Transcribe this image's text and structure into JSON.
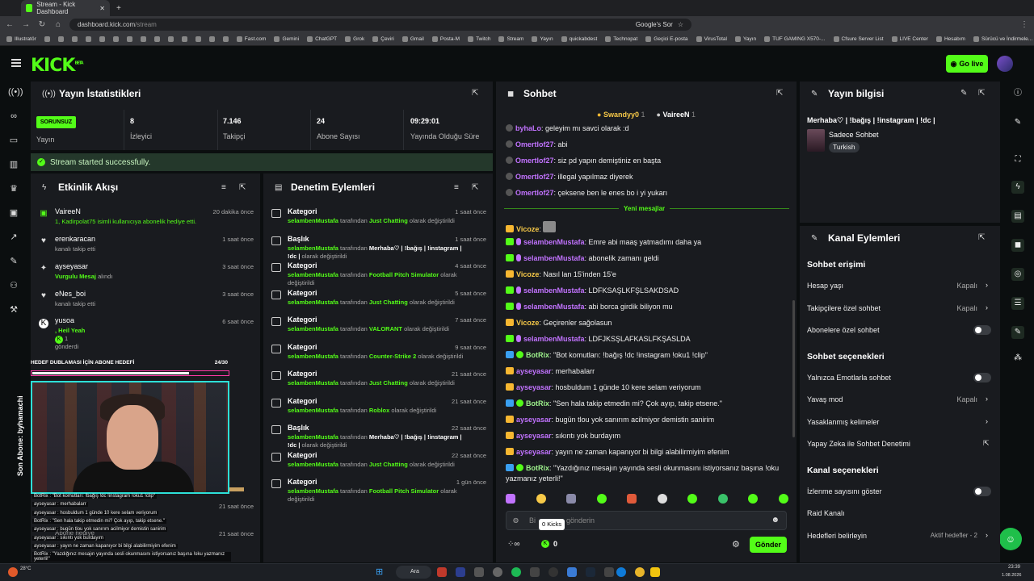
{
  "browser": {
    "tab_title": "Stream - Kick Dashboard",
    "url_host": "dashboard.kick.com",
    "url_path": "/stream",
    "search_chip": "Google's Sor",
    "bookmarks": [
      "Illustratör",
      "",
      "",
      "",
      "",
      "",
      "",
      "",
      "",
      "",
      "",
      "",
      "",
      "",
      "",
      "Fast.com",
      "Gemini",
      "ChatGPT",
      "Grok",
      "Çeviri",
      "Gmail",
      "Posta-M",
      "Twitch",
      "Stream",
      "Yayın",
      "quickabdest",
      "Technopat",
      "Geçici E-posta",
      "VirusTotal",
      "Yayın",
      "TUF GAMING X570-...",
      "Cfsure Server List",
      "LIVE Center",
      "Hesabım",
      "Sürücü ve İndirmele..."
    ]
  },
  "header": {
    "logo": "KICK",
    "logo_sup": "BETA",
    "golive_label": "Go live"
  },
  "stats": {
    "title": "Yayın İstatistikleri",
    "status_badge": "SORUNSUZ",
    "status_label": "Yayın",
    "items": [
      {
        "value": "8",
        "label": "İzleyici"
      },
      {
        "value": "7.146",
        "label": "Takipçi"
      },
      {
        "value": "24",
        "label": "Abone Sayısı"
      },
      {
        "value": "09:29:01",
        "label": "Yayında Olduğu Süre"
      }
    ],
    "started_msg": "Stream started successfully."
  },
  "activity": {
    "title": "Etkinlik Akışı",
    "items": [
      {
        "name": "VaireeN",
        "sub": "1, Kadirpolat75 isimli kullanıcıya abonelik hediye etti.",
        "time": "20 dakika önce"
      },
      {
        "name": "erenkaracan",
        "sub": "kanalı takip etti",
        "time": "1 saat önce"
      },
      {
        "name": "ayseyasar",
        "sub_green": "Vurgulu Mesaj",
        "sub": " alındı",
        "time": "3 saat önce"
      },
      {
        "name": "eNes_boi",
        "sub": "kanalı takip etti",
        "time": "3 saat önce"
      },
      {
        "name": "yusoa",
        "sub_green": ", Heil Yeah",
        "sub2": "1",
        "sub3": "gönderdi",
        "time": "6 saat önce"
      }
    ],
    "hidden_times": [
      "21 saat önce",
      "21 saat önce"
    ]
  },
  "moderation": {
    "title": "Denetim Eylemleri",
    "items": [
      {
        "type": "Kategori",
        "user": "selambenMustafa",
        "mid": " tarafından ",
        "target": "Just Chatting",
        "end": " olarak değiştirildi",
        "time": "1 saat önce"
      },
      {
        "type": "Başlık",
        "user": "selambenMustafa",
        "mid": " tarafından ",
        "target": "Merhaba♡ | !bağış | !instagram | !dc |",
        "end": " olarak değiştirildi",
        "time": "1 saat önce"
      },
      {
        "type": "Kategori",
        "user": "selambenMustafa",
        "mid": " tarafından ",
        "target": "Football Pitch Simulator",
        "end": " olarak değiştirildi",
        "time": "4 saat önce"
      },
      {
        "type": "Kategori",
        "user": "selambenMustafa",
        "mid": " tarafından ",
        "target": "Just Chatting",
        "end": " olarak değiştirildi",
        "time": "5 saat önce"
      },
      {
        "type": "Kategori",
        "user": "selambenMustafa",
        "mid": " tarafından ",
        "target": "VALORANT",
        "end": " olarak değiştirildi",
        "time": "7 saat önce"
      },
      {
        "type": "Kategori",
        "user": "selambenMustafa",
        "mid": " tarafından ",
        "target": "Counter-Strike 2",
        "end": " olarak değiştirildi",
        "time": "9 saat önce"
      },
      {
        "type": "Kategori",
        "user": "selambenMustafa",
        "mid": " tarafından ",
        "target": "Just Chatting",
        "end": " olarak değiştirildi",
        "time": "21 saat önce"
      },
      {
        "type": "Kategori",
        "user": "selambenMustafa",
        "mid": " tarafından ",
        "target": "Roblox",
        "end": " olarak değiştirildi",
        "time": "21 saat önce"
      },
      {
        "type": "Başlık",
        "user": "selambenMustafa",
        "mid": " tarafından ",
        "target": "Merhaba♡ | !bağış | !instagram | !dc |",
        "end": " olarak değiştirildi",
        "time": "22 saat önce"
      },
      {
        "type": "Kategori",
        "user": "selambenMustafa",
        "mid": " tarafından ",
        "target": "Just Chatting",
        "end": " olarak değiştirildi",
        "time": "22 saat önce"
      },
      {
        "type": "Kategori",
        "user": "selambenMustafa",
        "mid": " tarafından ",
        "target": "Football Pitch Simulator",
        "end": " olarak değiştirildi",
        "time": "1 gün önce"
      }
    ]
  },
  "chat": {
    "title": "Sohbet",
    "top_gifters": [
      {
        "name": "Swandyy0",
        "count": "1"
      },
      {
        "name": "VaireeN",
        "count": "1"
      }
    ],
    "old_messages": [
      {
        "user": "byhaLo",
        "text": ": geleyim mı savci olarak :d"
      },
      {
        "user": "Omertlof27",
        "text": ": abi"
      },
      {
        "user": "Omertlof27",
        "text": ": siz pd yapın demiştiniz en başta"
      },
      {
        "user": "Omertlof27",
        "text": ": illegal yapılmaz diyerek"
      },
      {
        "user": "Omertlof27",
        "text": ": çeksene ben le enes bo i yi yukarı"
      }
    ],
    "new_divider": "Yeni mesajlar",
    "new_messages": [
      {
        "user": "Vicoze",
        "text": ": ",
        "kind": "crown",
        "color": "yellow"
      },
      {
        "user": "selambenMustafa",
        "text": ": Emre abi maaş yatmadımı daha ya",
        "kind": "mod",
        "color": "purple"
      },
      {
        "user": "selambenMustafa",
        "text": ": abonelik zamanı geldi",
        "kind": "mod",
        "color": "purple"
      },
      {
        "user": "Vicoze",
        "text": ": Nasıl lan 15'inden 15'e",
        "kind": "crown",
        "color": "yellow"
      },
      {
        "user": "selambenMustafa",
        "text": ": LDFKSAŞLKFŞLSAKDSAD",
        "kind": "mod",
        "color": "purple"
      },
      {
        "user": "selambenMustafa",
        "text": ": abi borca girdik biliyon mu",
        "kind": "mod",
        "color": "purple"
      },
      {
        "user": "Vicoze",
        "text": ": Geçirenler sağolasun",
        "kind": "crown",
        "color": "yellow"
      },
      {
        "user": "selambenMustafa",
        "text": ": LDFJKSŞLAFKASLFKŞASLDA",
        "kind": "mod",
        "color": "purple"
      },
      {
        "user": "BotRix",
        "text": ": \"Bot komutları: !bağış !dc !instagram !oku1 !clip\"",
        "kind": "bot",
        "color": "ltgreen"
      },
      {
        "user": "ayseyasar",
        "text": ": merhabalarr",
        "kind": "crown",
        "color": "purple"
      },
      {
        "user": "ayseyasar",
        "text": ": hosbuldum 1 günde 10 kere selam veriyorum",
        "kind": "crown",
        "color": "purple"
      },
      {
        "user": "BotRix",
        "text": ": \"Sen hala takip etmedin mi? Çok ayıp, takip etsene.\"",
        "kind": "bot",
        "color": "ltgreen"
      },
      {
        "user": "ayseyasar",
        "text": ": bugün tlou yok sanırım acilmiyor demistin sanirim",
        "kind": "crown",
        "color": "purple"
      },
      {
        "user": "ayseyasar",
        "text": ": sıkıntı yok burdayım",
        "kind": "crown",
        "color": "purple"
      },
      {
        "user": "ayseyasar",
        "text": ": yayın ne zaman kapanıyor bi bilgi alabilirmiyim efenim",
        "kind": "crown",
        "color": "purple"
      },
      {
        "user": "BotRix",
        "text": ": \"Yazdığınız mesajın yayında sesli okunmasını istiyorsanız başına !oku",
        "kind": "bot",
        "color": "ltgreen"
      }
    ],
    "last_line_cont": "yazmanız yeterli!\"",
    "input_placeholder_a": "Bi",
    "input_placeholder_b": "gönderin",
    "kicks_tooltip": "0 Kicks",
    "kicks_count": "0",
    "send_label": "Gönder"
  },
  "stream_info": {
    "title": "Yayın bilgisi",
    "stream_title": "Merhaba♡ | !bağış | !instagram | !dc |",
    "category": "Sadece Sohbet",
    "language": "Turkish"
  },
  "channel_actions": {
    "title": "Kanal Eylemleri",
    "sections": [
      {
        "heading": "Sohbet erişimi"
      },
      {
        "label": "Hesap yaşı",
        "value": "Kapalı",
        "ctrl": "chevron"
      },
      {
        "label": "Takipçilere özel sohbet",
        "value": "Kapalı",
        "ctrl": "chevron"
      },
      {
        "label": "Abonelere özel sohbet",
        "ctrl": "toggle"
      },
      {
        "heading": "Sohbet seçenekleri"
      },
      {
        "label": "Yalnızca Emotlarla sohbet",
        "ctrl": "toggle"
      },
      {
        "label": "Yavaş mod",
        "value": "Kapalı",
        "ctrl": "chevron"
      },
      {
        "label": "Yasaklanmış kelimeler",
        "ctrl": "chevron"
      },
      {
        "label": "Yapay Zeka ile Sohbet Denetimi",
        "ctrl": "external"
      },
      {
        "heading": "Kanal seçenekleri"
      },
      {
        "label": "İzlenme sayısını göster",
        "ctrl": "toggle"
      },
      {
        "label": "Raid Kanalı"
      },
      {
        "label": "Hedefleri belirleyin",
        "value": "Aktif hedefler - 2",
        "ctrl": "chevron"
      }
    ]
  },
  "overlay": {
    "goal_text": "HEDEF DUBLAMASI İÇİN ABONE HEDEFİ",
    "goal_count": "24/30",
    "goal_fraction": 0.8,
    "last_sub": "Son Abone: byhamachi",
    "chat_lines": [
      "BotRix : \"Bot komutları: !bağış !dc !instagram !oku1 !clip\"",
      "ayseyasar : merhabalarr",
      "ayseyasar : hosbuldum 1 günde 10 kere selam veriyorum",
      "BotRix : \"Sen hala takip etmedin mi? Çok ayıp, takip etsene.\"",
      "ayseyasar : bugün tlou yok sanırım acilmiyor demistin sanirim",
      "ayseyasar : sıkıntı yok burdayım",
      "ayseyasar : yayın ne zaman kapanıyor bi bilgi alabilirmiyim efenim",
      "BotRix : \"Yazdığınız mesajın yayında sesli okunmasını istiyorsanız başına !oku yazmanız yeterli!\""
    ],
    "ghost_label": "Abone hediye"
  },
  "taskbar": {
    "weather": "28°C",
    "search_label": "Ara",
    "time": "23:39",
    "date": "1.08.2026"
  },
  "colors": {
    "accent": "#53fc18",
    "panel": "#191b1f",
    "bg": "#0b0e0f"
  }
}
